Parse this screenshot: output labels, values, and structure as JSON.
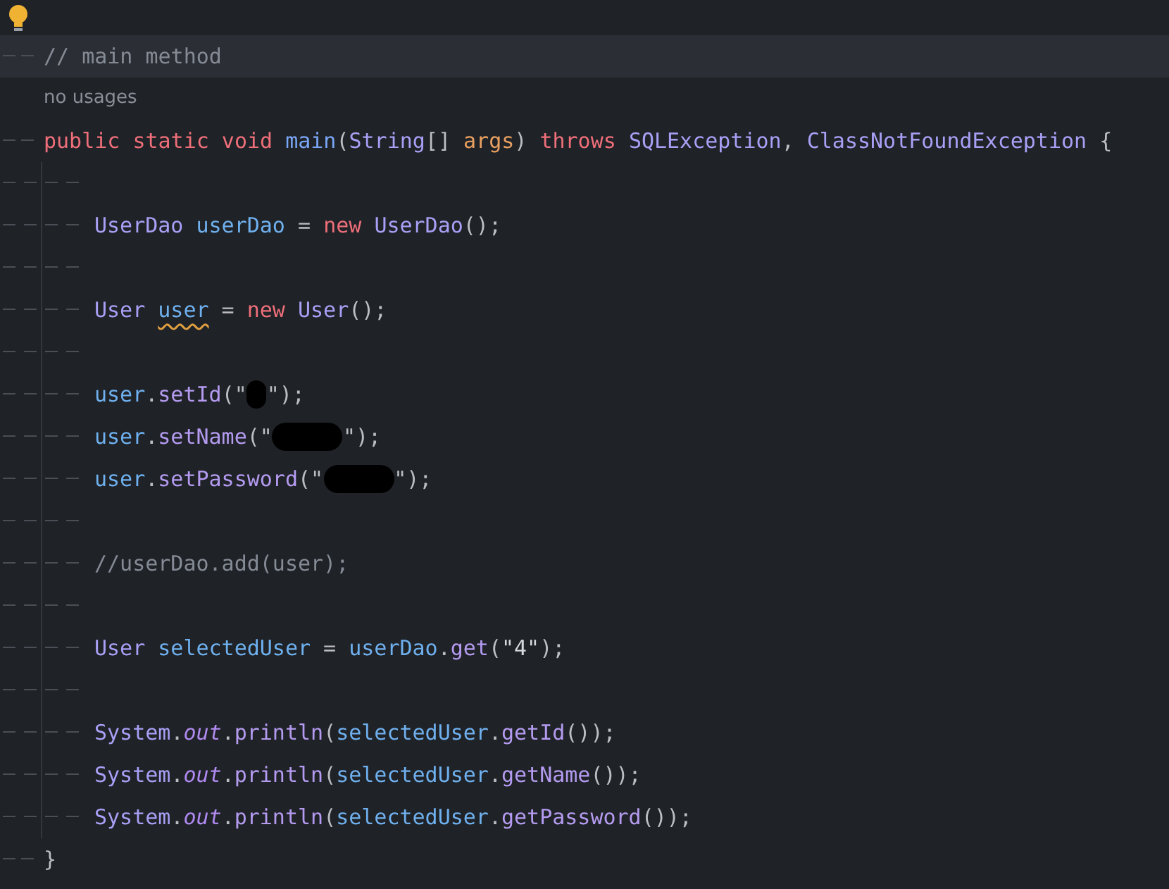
{
  "lines": [
    {
      "kind": "top",
      "highlighted": true,
      "tokens": [
        {
          "text": "// main method",
          "kind": "comment"
        }
      ]
    },
    {
      "kind": "hint",
      "text": "no usages"
    },
    {
      "kind": "top",
      "highlighted": false,
      "tokens": [
        {
          "text": "public static void ",
          "kind": "kw"
        },
        {
          "text": "main",
          "kind": "fn"
        },
        {
          "text": "(",
          "kind": "punct"
        },
        {
          "text": "String",
          "kind": "type"
        },
        {
          "text": "[] ",
          "kind": "punct"
        },
        {
          "text": "args",
          "kind": "param"
        },
        {
          "text": ") ",
          "kind": "punct"
        },
        {
          "text": "throws ",
          "kind": "kw"
        },
        {
          "text": "SQLException",
          "kind": "type"
        },
        {
          "text": ", ",
          "kind": "punct"
        },
        {
          "text": "ClassNotFoundException",
          "kind": "type"
        },
        {
          "text": " {",
          "kind": "punct"
        }
      ]
    },
    {
      "kind": "body",
      "highlighted": false
    },
    {
      "kind": "body",
      "highlighted": false,
      "tokens": [
        {
          "text": "UserDao ",
          "kind": "type"
        },
        {
          "text": "userDao",
          "kind": "var"
        },
        {
          "text": " = ",
          "kind": "punct"
        },
        {
          "text": "new ",
          "kind": "kw"
        },
        {
          "text": "UserDao",
          "kind": "type"
        },
        {
          "text": "();",
          "kind": "punct"
        }
      ]
    },
    {
      "kind": "body",
      "highlighted": false
    },
    {
      "kind": "body",
      "highlighted": false,
      "tokens": [
        {
          "text": "User ",
          "kind": "type"
        },
        {
          "text": "user",
          "kind": "var",
          "warning": true
        },
        {
          "text": " = ",
          "kind": "punct"
        },
        {
          "text": "new ",
          "kind": "kw"
        },
        {
          "text": "User",
          "kind": "type"
        },
        {
          "text": "();",
          "kind": "punct"
        }
      ]
    },
    {
      "kind": "body",
      "highlighted": false
    },
    {
      "kind": "body",
      "highlighted": false,
      "tokens": [
        {
          "text": "user",
          "kind": "var"
        },
        {
          "text": ".",
          "kind": "punct"
        },
        {
          "text": "setId",
          "kind": "call"
        },
        {
          "text": "(\"",
          "kind": "punct"
        },
        {
          "kind": "dot"
        },
        {
          "text": "\");",
          "kind": "punct"
        }
      ]
    },
    {
      "kind": "body",
      "highlighted": false,
      "tokens": [
        {
          "text": "user",
          "kind": "var"
        },
        {
          "text": ".",
          "kind": "punct"
        },
        {
          "text": "setName",
          "kind": "call"
        },
        {
          "text": "(\"",
          "kind": "punct"
        },
        {
          "kind": "blot"
        },
        {
          "text": "\");",
          "kind": "punct"
        }
      ]
    },
    {
      "kind": "body",
      "highlighted": false,
      "tokens": [
        {
          "text": "user",
          "kind": "var"
        },
        {
          "text": ".",
          "kind": "punct"
        },
        {
          "text": "setPassword",
          "kind": "call"
        },
        {
          "text": "(\"",
          "kind": "punct"
        },
        {
          "kind": "blot"
        },
        {
          "text": "\");",
          "kind": "punct"
        }
      ]
    },
    {
      "kind": "body",
      "highlighted": false
    },
    {
      "kind": "body",
      "highlighted": false,
      "tokens": [
        {
          "text": "//userDao.add(user);",
          "kind": "comment"
        }
      ]
    },
    {
      "kind": "body",
      "highlighted": false
    },
    {
      "kind": "body",
      "highlighted": false,
      "tokens": [
        {
          "text": "User ",
          "kind": "type"
        },
        {
          "text": "selectedUser",
          "kind": "var"
        },
        {
          "text": " = ",
          "kind": "punct"
        },
        {
          "text": "userDao",
          "kind": "var"
        },
        {
          "text": ".",
          "kind": "punct"
        },
        {
          "text": "get",
          "kind": "call"
        },
        {
          "text": "(",
          "kind": "punct"
        },
        {
          "text": "\"4\"",
          "kind": "str"
        },
        {
          "text": ");",
          "kind": "punct"
        }
      ]
    },
    {
      "kind": "body",
      "highlighted": false
    },
    {
      "kind": "body",
      "highlighted": false,
      "tokens": [
        {
          "text": "System",
          "kind": "type"
        },
        {
          "text": ".",
          "kind": "punct"
        },
        {
          "text": "out",
          "kind": "field"
        },
        {
          "text": ".",
          "kind": "punct"
        },
        {
          "text": "println",
          "kind": "call"
        },
        {
          "text": "(",
          "kind": "punct"
        },
        {
          "text": "selectedUser",
          "kind": "var"
        },
        {
          "text": ".",
          "kind": "punct"
        },
        {
          "text": "getId",
          "kind": "call"
        },
        {
          "text": "());",
          "kind": "punct"
        }
      ]
    },
    {
      "kind": "body",
      "highlighted": false,
      "tokens": [
        {
          "text": "System",
          "kind": "type"
        },
        {
          "text": ".",
          "kind": "punct"
        },
        {
          "text": "out",
          "kind": "field"
        },
        {
          "text": ".",
          "kind": "punct"
        },
        {
          "text": "println",
          "kind": "call"
        },
        {
          "text": "(",
          "kind": "punct"
        },
        {
          "text": "selectedUser",
          "kind": "var"
        },
        {
          "text": ".",
          "kind": "punct"
        },
        {
          "text": "getName",
          "kind": "call"
        },
        {
          "text": "());",
          "kind": "punct"
        }
      ]
    },
    {
      "kind": "body",
      "highlighted": false,
      "tokens": [
        {
          "text": "System",
          "kind": "type"
        },
        {
          "text": ".",
          "kind": "punct"
        },
        {
          "text": "out",
          "kind": "field"
        },
        {
          "text": ".",
          "kind": "punct"
        },
        {
          "text": "println",
          "kind": "call"
        },
        {
          "text": "(",
          "kind": "punct"
        },
        {
          "text": "selectedUser",
          "kind": "var"
        },
        {
          "text": ".",
          "kind": "punct"
        },
        {
          "text": "getPassword",
          "kind": "call"
        },
        {
          "text": "());",
          "kind": "punct"
        }
      ]
    },
    {
      "kind": "top",
      "highlighted": false,
      "tokens": [
        {
          "text": "}",
          "kind": "punct"
        }
      ]
    }
  ]
}
